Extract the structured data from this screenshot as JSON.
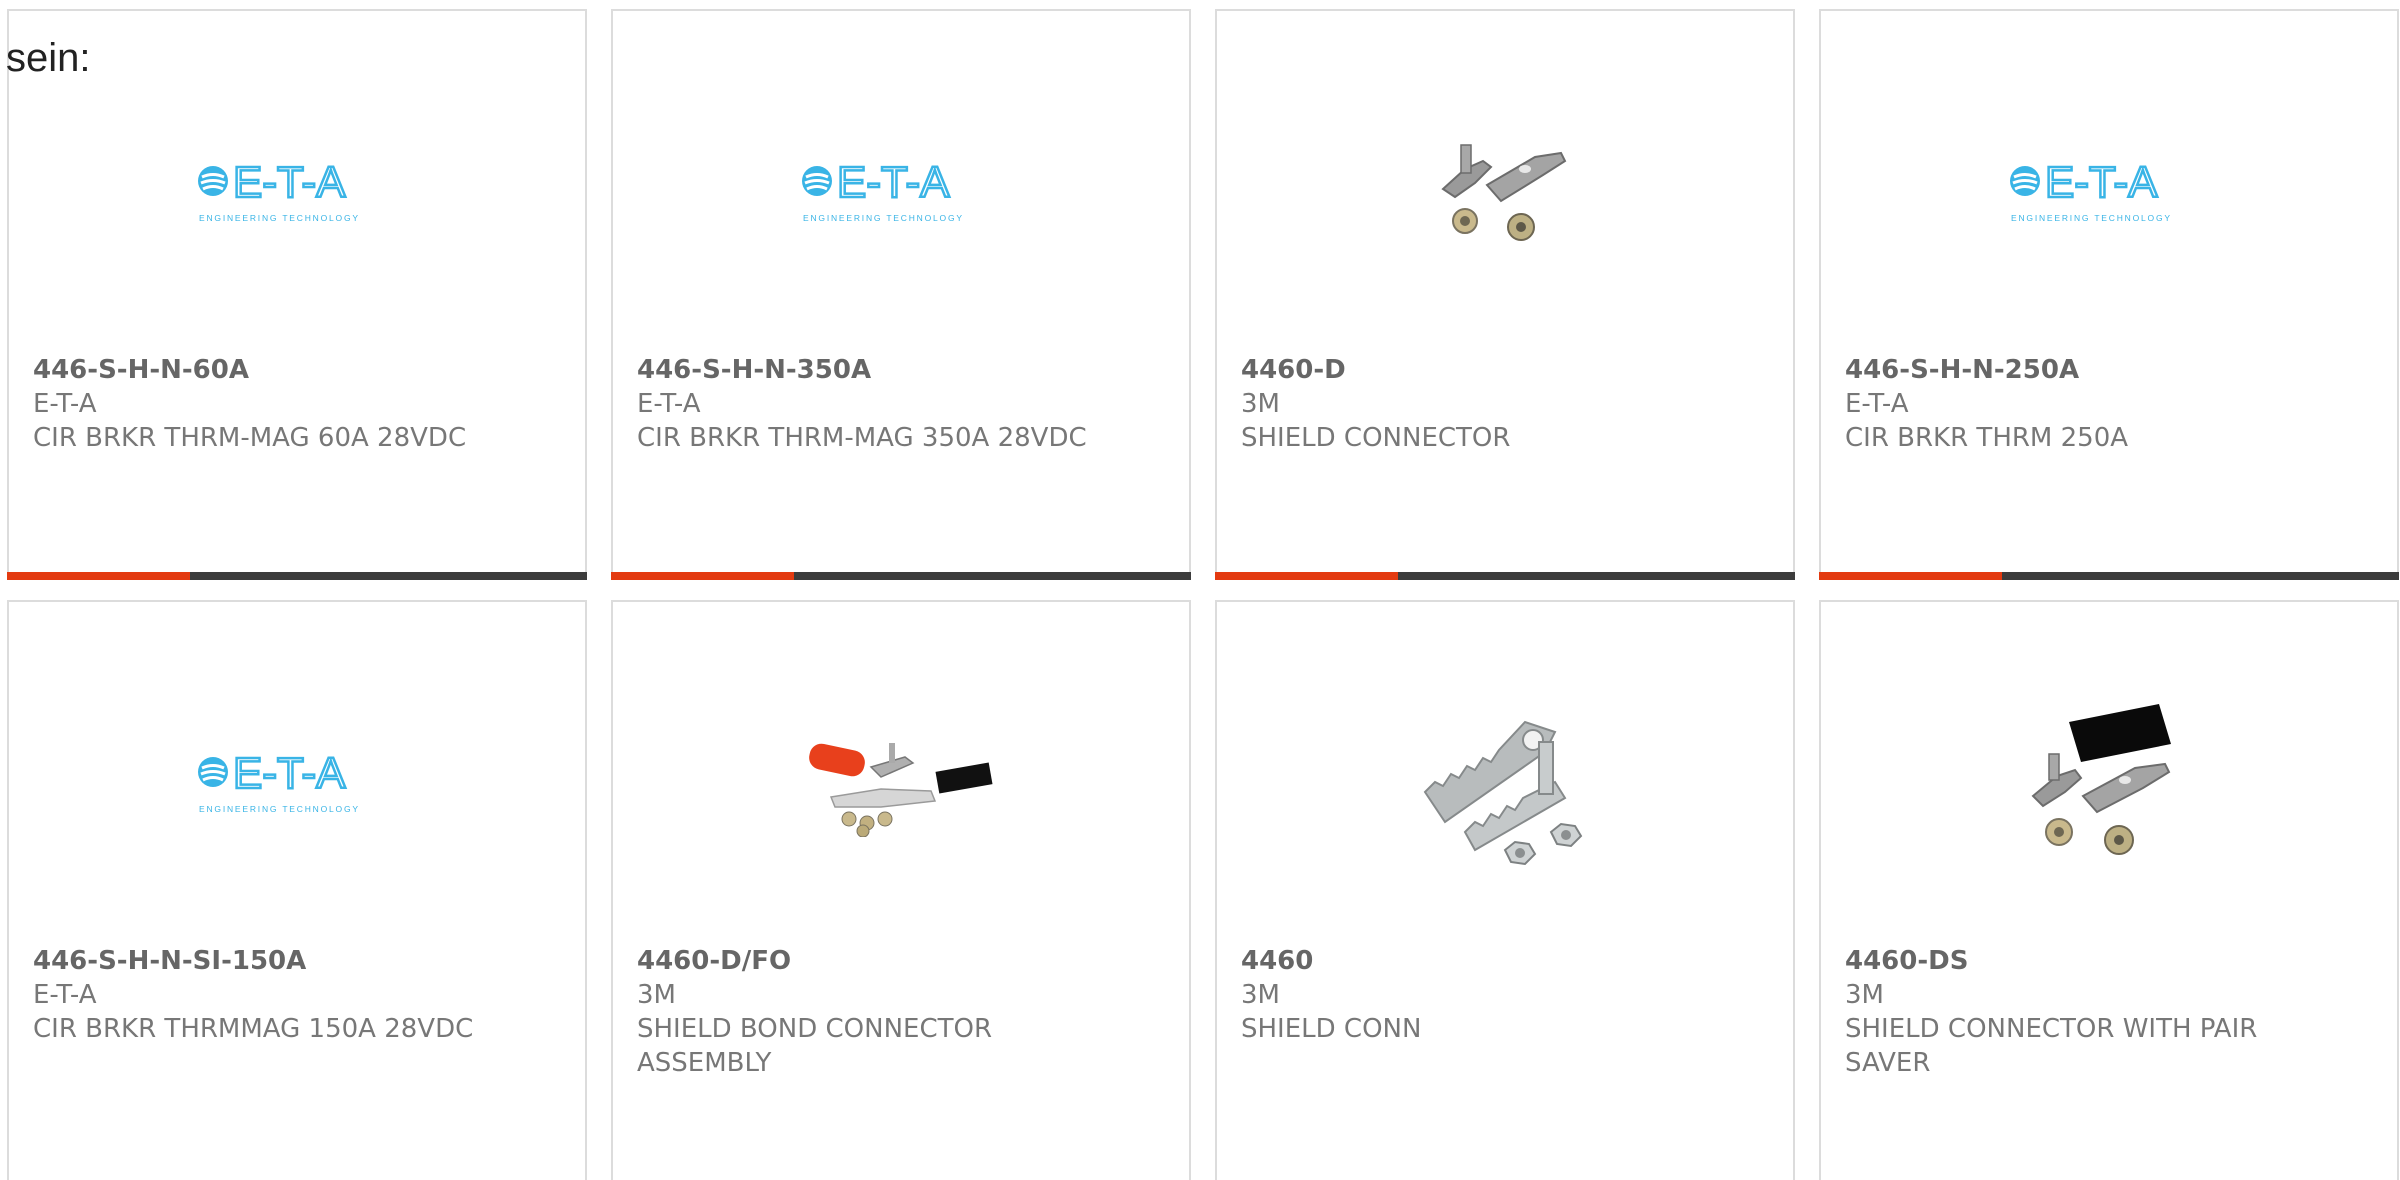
{
  "intro_text": "sein:",
  "logo": {
    "name": "E-T-A",
    "tagline": "ENGINEERING TECHNOLOGY",
    "color": "#39b4e6"
  },
  "accent_color": "#e33a10",
  "products": [
    {
      "part_number": "446-S-H-N-60A",
      "manufacturer": "E-T-A",
      "description": "CIR BRKR THRM-MAG 60A 28VDC",
      "image": "eta-logo"
    },
    {
      "part_number": "446-S-H-N-350A",
      "manufacturer": "E-T-A",
      "description": "CIR BRKR THRM-MAG 350A 28VDC",
      "image": "eta-logo"
    },
    {
      "part_number": "4460-D",
      "manufacturer": "3M",
      "description": "SHIELD CONNECTOR",
      "image": "shield-connector-photo"
    },
    {
      "part_number": "446-S-H-N-250A",
      "manufacturer": "E-T-A",
      "description": "CIR BRKR THRM 250A",
      "image": "eta-logo"
    },
    {
      "part_number": "446-S-H-N-SI-150A",
      "manufacturer": "E-T-A",
      "description": "CIR BRKR THRMMAG 150A 28VDC",
      "image": "eta-logo"
    },
    {
      "part_number": "4460-D/FO",
      "manufacturer": "3M",
      "description": "SHIELD BOND CONNECTOR ASSEMBLY",
      "image": "shield-bond-assembly-photo"
    },
    {
      "part_number": "4460",
      "manufacturer": "3M",
      "description": "SHIELD CONN",
      "image": "shield-conn-photo"
    },
    {
      "part_number": "4460-DS",
      "manufacturer": "3M",
      "description": "SHIELD CONNECTOR WITH PAIR SAVER",
      "image": "shield-connector-pair-saver-photo"
    }
  ]
}
